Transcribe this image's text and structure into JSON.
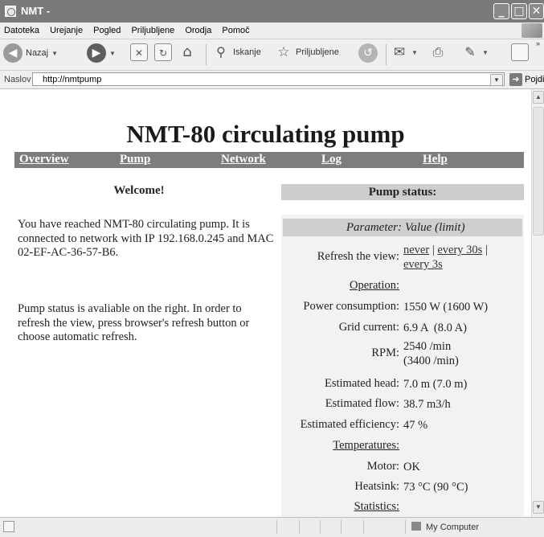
{
  "window": {
    "title": "NMT -"
  },
  "menu": [
    "Datoteka",
    "Urejanje",
    "Pogled",
    "Priljubljene",
    "Orodja",
    "Pomoč"
  ],
  "toolbar": {
    "back": "Nazaj",
    "search": "Iskanje",
    "favorites": "Priljubljene"
  },
  "address": {
    "label": "Naslov",
    "url": "http://nmtpump",
    "go": "Pojdi"
  },
  "page": {
    "title": "NMT-80 circulating pump",
    "nav": [
      "Overview",
      "Pump",
      "Network",
      "Log",
      "Help"
    ],
    "welcome": "Welcome!",
    "paragraph1": "You have reached NMT-80 circulating pump. It is connected to network with IP 192.168.0.245 and MAC 02-EF-AC-36-57-B6.",
    "paragraph2": "Pump status is avaliable on the right. In order to refresh the view, press browser's refresh button or choose automatic refresh."
  },
  "status": {
    "header": "Pump status:",
    "param_col": "Parameter:",
    "value_col": "Value (limit)",
    "refresh_label": "Refresh the view:",
    "refresh_never": "never",
    "refresh_30s": "every 30s",
    "refresh_3s": "every 3s",
    "operation": "Operation:",
    "power_label": "Power consumption:",
    "power_value": "1550 W (1600 W)",
    "grid_label": "Grid current:",
    "grid_value": "6.9 A  (8.0 A)",
    "rpm_label": "RPM:",
    "rpm_value1": "2540 /min",
    "rpm_value2": "(3400 /min)",
    "head_label": "Estimated head:",
    "head_value": "7.0 m (7.0 m)",
    "flow_label": "Estimated flow:",
    "flow_value": "38.7 m3/h",
    "eff_label": "Estimated efficiency:",
    "eff_value": "47 %",
    "temperatures": "Temperatures:",
    "motor_label": "Motor:",
    "motor_value": "OK",
    "heatsink_label": "Heatsink:",
    "heatsink_value": "73 °C (90 °C)",
    "statistics": "Statistics:"
  },
  "statusbar": {
    "zone": "My Computer"
  }
}
